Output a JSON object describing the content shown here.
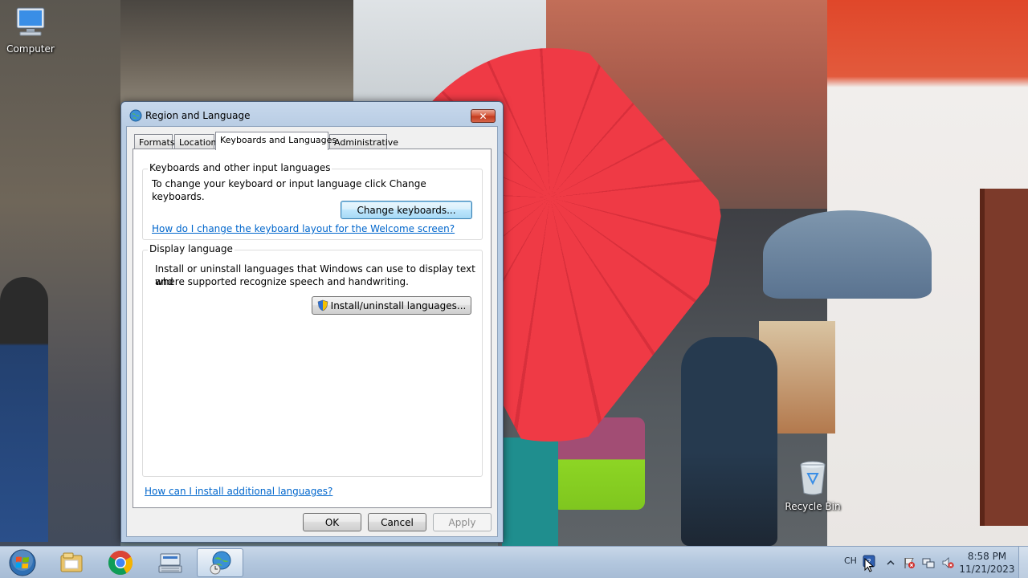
{
  "desktop": {
    "icons": [
      {
        "label": "Computer"
      },
      {
        "label": "Recycle Bin"
      }
    ]
  },
  "window": {
    "title": "Region and Language",
    "close_glyph": "✕",
    "tabs": [
      {
        "label": "Formats"
      },
      {
        "label": "Location"
      },
      {
        "label": "Keyboards and Languages"
      },
      {
        "label": "Administrative"
      }
    ],
    "active_tab": "Keyboards and Languages",
    "keyboards_group": {
      "title": "Keyboards and other input languages",
      "description": "To change your keyboard or input language click Change keyboards.",
      "button": "Change keyboards...",
      "link": "How do I change the keyboard layout for the Welcome screen?"
    },
    "display_group": {
      "title": "Display language",
      "description_line1": "Install or uninstall languages that Windows can use to display text and",
      "description_line2": "where supported recognize speech and handwriting.",
      "button": "Install/uninstall languages..."
    },
    "bottom_link": "How can I install additional languages?",
    "buttons": {
      "ok": "OK",
      "cancel": "Cancel",
      "apply": "Apply"
    }
  },
  "taskbar": {
    "language_indicator": "CH",
    "clock_time": "8:58 PM",
    "clock_date": "11/21/2023",
    "items": [
      {
        "icon": "file-explorer-icon"
      },
      {
        "icon": "chrome-icon"
      },
      {
        "icon": "keyboard-settings-icon"
      },
      {
        "icon": "region-language-icon",
        "active": true
      }
    ]
  },
  "colors": {
    "link": "#0066cc",
    "taskbar": "#b3c7de",
    "close_button": "#c23b1f"
  }
}
